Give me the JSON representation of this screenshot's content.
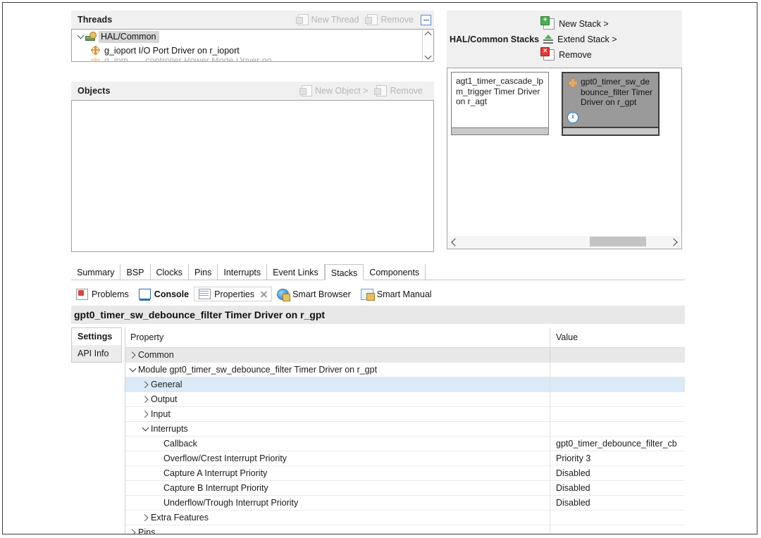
{
  "threads_panel": {
    "title": "Threads",
    "actions": [
      {
        "label": "New Thread",
        "icon": "new-thread-icon"
      },
      {
        "label": "Remove",
        "icon": "remove-thread-icon"
      }
    ],
    "collapse_icon": "collapse-all-icon",
    "tree": [
      {
        "label": "HAL/Common",
        "icon": "hal-common-icon",
        "expanded": true,
        "selected": true,
        "level": 0
      },
      {
        "label": "g_ioport I/O Port Driver on r_ioport",
        "icon": "module-icon",
        "level": 1
      }
    ]
  },
  "objects_panel": {
    "title": "Objects",
    "actions": [
      {
        "label": "New Object >",
        "icon": "new-object-icon"
      },
      {
        "label": "Remove",
        "icon": "remove-object-icon"
      }
    ]
  },
  "stacks_panel": {
    "title": "HAL/Common Stacks",
    "actions": [
      {
        "label": "New Stack >",
        "icon": "new-stack-icon"
      },
      {
        "label": "Extend Stack >",
        "icon": "extend-stack-icon"
      },
      {
        "label": "Remove",
        "icon": "remove-stack-icon"
      }
    ],
    "cards": [
      {
        "label": "agt1_timer_cascade_lpm_trigger Timer Driver on r_agt",
        "selected": false,
        "has_icon": false,
        "has_info": false
      },
      {
        "label": "gpt0_timer_sw_debounce_filter Timer Driver on r_gpt",
        "selected": true,
        "has_icon": true,
        "has_info": true,
        "icon": "gpt-module-icon",
        "info_icon": "info-icon"
      }
    ],
    "hscroll": {
      "left_icon": "scroll-left-icon",
      "right_icon": "scroll-right-icon"
    }
  },
  "config_tabs": {
    "items": [
      {
        "label": "Summary",
        "active": false
      },
      {
        "label": "BSP",
        "active": false
      },
      {
        "label": "Clocks",
        "active": false
      },
      {
        "label": "Pins",
        "active": false
      },
      {
        "label": "Interrupts",
        "active": false
      },
      {
        "label": "Event Links",
        "active": false
      },
      {
        "label": "Stacks",
        "active": true
      },
      {
        "label": "Components",
        "active": false
      }
    ]
  },
  "view_tabs": {
    "items": [
      {
        "label": "Problems",
        "icon": "problems-icon",
        "active": false,
        "closable": false
      },
      {
        "label": "Console",
        "icon": "console-icon",
        "active": false,
        "bold": true,
        "closable": false
      },
      {
        "label": "Properties",
        "icon": "properties-icon",
        "active": true,
        "closable": true,
        "close_icon": "close-icon"
      },
      {
        "label": "Smart Browser",
        "icon": "smart-browser-icon",
        "active": false,
        "closable": false
      },
      {
        "label": "Smart Manual",
        "icon": "smart-manual-icon",
        "active": false,
        "closable": false
      }
    ]
  },
  "properties": {
    "title": "gpt0_timer_sw_debounce_filter Timer Driver on r_gpt",
    "side_tabs": [
      {
        "label": "Settings",
        "active": true
      },
      {
        "label": "API Info",
        "active": false
      }
    ],
    "columns": {
      "property": "Property",
      "value": "Value"
    },
    "rows": [
      {
        "label": "Common",
        "value": "",
        "indent": 0,
        "twisty": "right",
        "shaded": true,
        "selected": false
      },
      {
        "label": "Module gpt0_timer_sw_debounce_filter Timer Driver on r_gpt",
        "value": "",
        "indent": 0,
        "twisty": "down",
        "shaded": false,
        "selected": false
      },
      {
        "label": "General",
        "value": "",
        "indent": 1,
        "twisty": "right",
        "shaded": false,
        "selected": true
      },
      {
        "label": "Output",
        "value": "",
        "indent": 1,
        "twisty": "right",
        "shaded": false,
        "selected": false
      },
      {
        "label": "Input",
        "value": "",
        "indent": 1,
        "twisty": "right",
        "shaded": false,
        "selected": false
      },
      {
        "label": "Interrupts",
        "value": "",
        "indent": 1,
        "twisty": "down",
        "shaded": false,
        "selected": false
      },
      {
        "label": "Callback",
        "value": "gpt0_timer_debounce_filter_cb",
        "indent": 2,
        "twisty": "none",
        "shaded": false,
        "selected": false
      },
      {
        "label": "Overflow/Crest Interrupt Priority",
        "value": "Priority 3",
        "indent": 2,
        "twisty": "none",
        "shaded": false,
        "selected": false
      },
      {
        "label": "Capture A Interrupt Priority",
        "value": "Disabled",
        "indent": 2,
        "twisty": "none",
        "shaded": false,
        "selected": false
      },
      {
        "label": "Capture B Interrupt Priority",
        "value": "Disabled",
        "indent": 2,
        "twisty": "none",
        "shaded": false,
        "selected": false
      },
      {
        "label": "Underflow/Trough Interrupt Priority",
        "value": "Disabled",
        "indent": 2,
        "twisty": "none",
        "shaded": false,
        "selected": false
      },
      {
        "label": "Extra Features",
        "value": "",
        "indent": 1,
        "twisty": "right",
        "shaded": false,
        "selected": false
      },
      {
        "label": "Pins",
        "value": "",
        "indent": 0,
        "twisty": "right",
        "shaded": false,
        "selected": false
      }
    ]
  },
  "colors": {
    "panel_header_bg": "#f0f0f0",
    "selection_blue": "#dbeaf7",
    "shaded_row": "#e8e8e8",
    "title_bar_bg": "#e8e8e8",
    "selected_card_bg": "#9a9a9a",
    "disabled_text": "#b6b6b6"
  }
}
